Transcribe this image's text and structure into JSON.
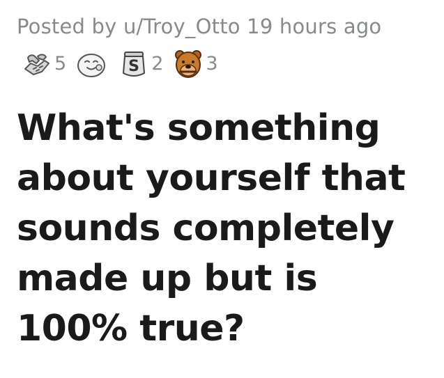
{
  "post": {
    "posted_by_prefix": "Posted by",
    "author": "u/Troy_Otto",
    "age": "19 hours ago",
    "title": "What's something about yourself that sounds completely made up but is 100% true?"
  },
  "awards": [
    {
      "icon": "handshake-award-icon",
      "count": "5"
    },
    {
      "icon": "wholesome-face-award-icon",
      "count": ""
    },
    {
      "icon": "silver-s-award-icon",
      "count": "2"
    },
    {
      "icon": "bear-award-icon",
      "count": "3"
    }
  ]
}
